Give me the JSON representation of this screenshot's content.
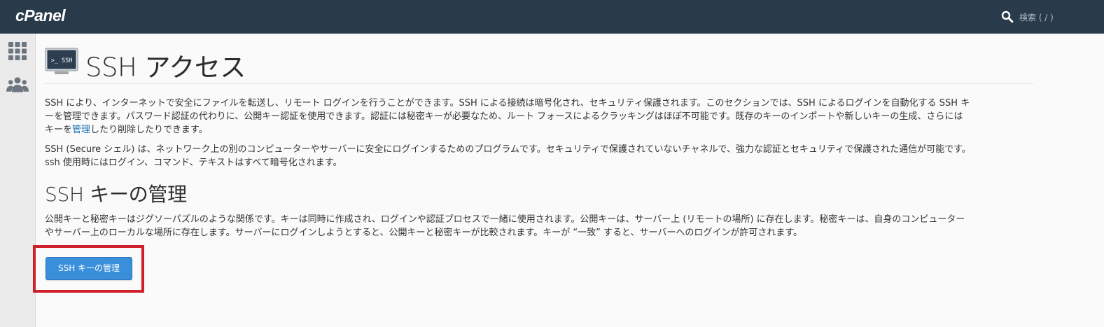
{
  "header": {
    "logo": "cPanel",
    "search_label": "検索 ( / )",
    "background": "#293a4a"
  },
  "sidebar": {
    "items": [
      {
        "icon": "grid-icon"
      },
      {
        "icon": "users-icon"
      }
    ]
  },
  "page": {
    "icon_text": ">_ SSH",
    "title": "SSH アクセス",
    "intro_1_lines": [
      "SSH により、インターネットで安全にファイルを転送し、リモート ログインを行うことができます。SSH による接続は暗号化され、セキュリティ保護されます。このセクションでは、SSH によるログインを自動化する SSH キ",
      "ーを管理できます。パスワード認証の代わりに、公開キー認証を使用できます。認証には秘密キーが必要なため、ルート フォースによるクラッキングはほぼ不可能です。既存のキーのインポートや新しいキーの生成、さらには"
    ],
    "intro_1_last_prefix": "キーを",
    "intro_1_link": "管理",
    "intro_1_last_suffix": "したり削除したりできます。",
    "intro_2_lines": [
      "SSH (Secure シェル) は、ネットワーク上の別のコンピューターやサーバーに安全にログインするためのプログラムです。セキュリティで保護されていないチャネルで、強力な認証とセキュリティで保護された通信が可能です。",
      "ssh 使用時にはログイン、コマンド、テキストはすべて暗号化されます。"
    ],
    "section_title": "SSH キーの管理",
    "section_lines": [
      "公開キーと秘密キーはジグソーパズルのような関係です。キーは同時に作成され、ログインや認証プロセスで一緒に使用されます。公開キーは、サーバー上 (リモートの場所) に存在します。秘密キーは、自身のコンピューター",
      "やサーバー上のローカルな場所に存在します。サーバーにログインしようとすると、公開キーと秘密キーが比較されます。キーが “一致” すると、サーバーへのログインが許可されます。"
    ],
    "manage_button": "SSH キーの管理"
  },
  "colors": {
    "accent": "#3a8fdb",
    "highlight": "#d0202a",
    "link": "#1a73b8"
  }
}
